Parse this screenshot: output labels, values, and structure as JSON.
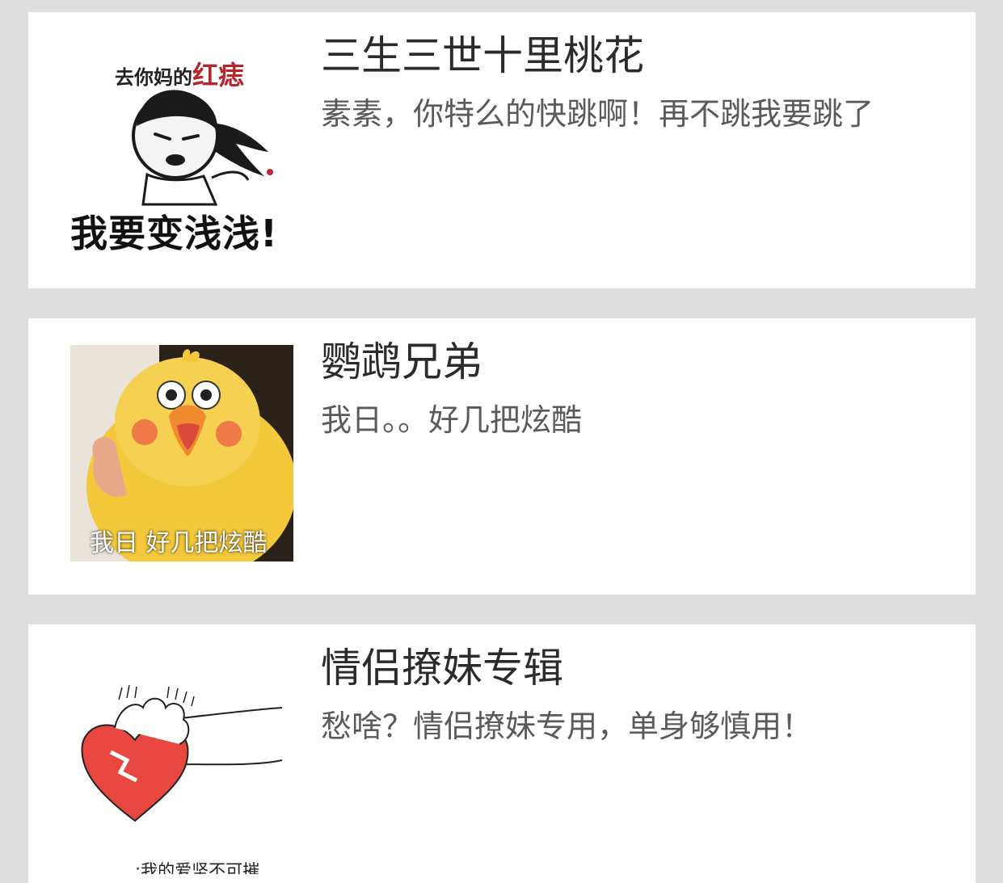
{
  "items": [
    {
      "title": "三生三世十里桃花",
      "description": "素素，你特么的快跳啊！再不跳我要跳了",
      "meme": {
        "top_text": "去你妈的",
        "top_text_red": "红痣",
        "bottom_text": "我要变浅浅!"
      }
    },
    {
      "title": "鹦鹉兄弟",
      "description": "我日。。好几把炫酷",
      "meme": {
        "caption": "我日  好几把炫酷"
      }
    },
    {
      "title": "情侣撩妹专辑",
      "description": "愁啥？情侣撩妹专用，单身够慎用！",
      "meme": {
        "caption": ":我的爱坚不可摧"
      }
    }
  ],
  "colors": {
    "background": "#dedede",
    "card": "#ffffff",
    "title": "#2b2b2b",
    "description": "#5a5a5a",
    "meme_red": "#b3262b",
    "heart": "#e8473f",
    "chick": "#f3c83a"
  }
}
